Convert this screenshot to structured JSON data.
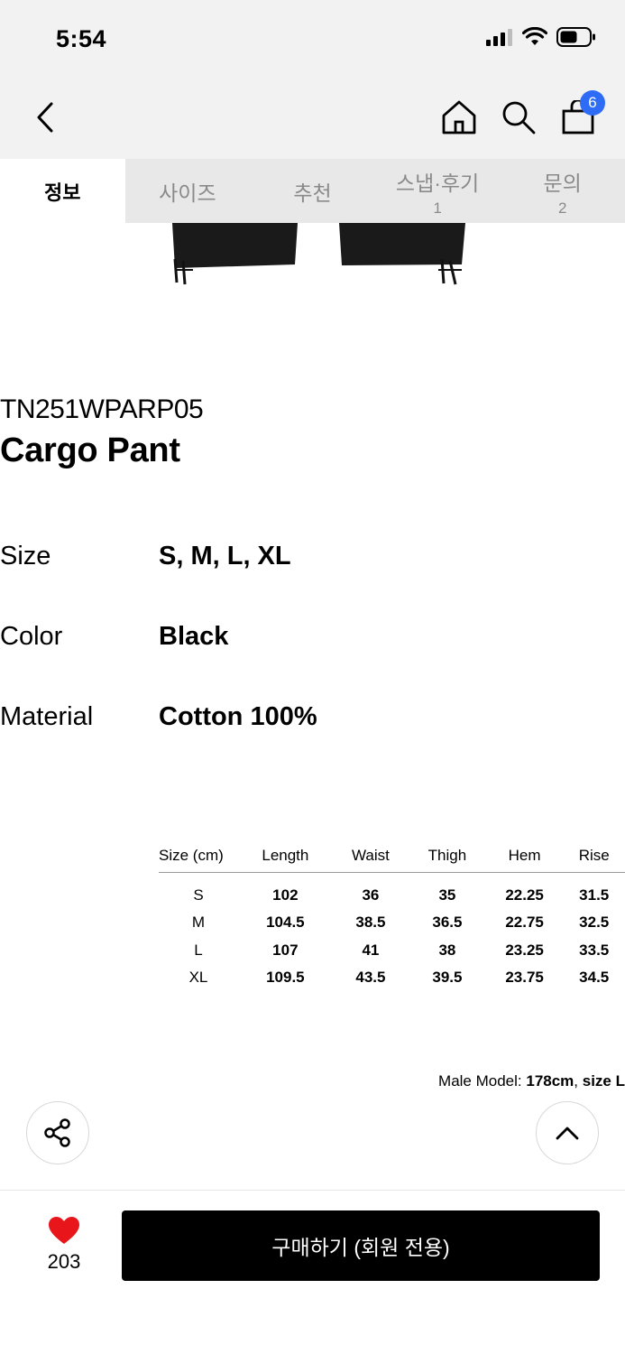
{
  "status_bar": {
    "time": "5:54"
  },
  "header": {
    "cart_count": "6"
  },
  "tabs": [
    {
      "label": "정보",
      "count": ""
    },
    {
      "label": "사이즈",
      "count": ""
    },
    {
      "label": "추천",
      "count": ""
    },
    {
      "label": "스냅·후기",
      "count": "1"
    },
    {
      "label": "문의",
      "count": "2"
    }
  ],
  "product": {
    "code": "TN251WPARP05",
    "name": "Cargo Pant",
    "specs": [
      {
        "label": "Size",
        "value": "S, M, L, XL"
      },
      {
        "label": "Color",
        "value": "Black"
      },
      {
        "label": "Material",
        "value": "Cotton 100%"
      }
    ]
  },
  "size_table": {
    "headers": [
      "Size (cm)",
      "Length",
      "Waist",
      "Thigh",
      "Hem",
      "Rise"
    ],
    "rows": [
      [
        "S",
        "102",
        "36",
        "35",
        "22.25",
        "31.5"
      ],
      [
        "M",
        "104.5",
        "38.5",
        "36.5",
        "22.75",
        "32.5"
      ],
      [
        "L",
        "107",
        "41",
        "38",
        "23.25",
        "33.5"
      ],
      [
        "XL",
        "109.5",
        "43.5",
        "39.5",
        "23.75",
        "34.5"
      ]
    ]
  },
  "model_note": {
    "prefix": "Male Model: ",
    "height": "178cm",
    "sep": ", ",
    "size": "size L"
  },
  "bottom": {
    "like_count": "203",
    "buy_label": "구매하기 (회원 전용)"
  },
  "icons": {
    "back": "chevron-left-icon",
    "home": "home-icon",
    "search": "search-icon",
    "cart": "shopping-bag-icon",
    "share": "share-icon",
    "scroll_top": "chevron-up-icon",
    "like": "heart-icon"
  },
  "colors": {
    "badge": "#2f6cf6",
    "heart": "#e8161b",
    "buy_button": "#000000"
  }
}
